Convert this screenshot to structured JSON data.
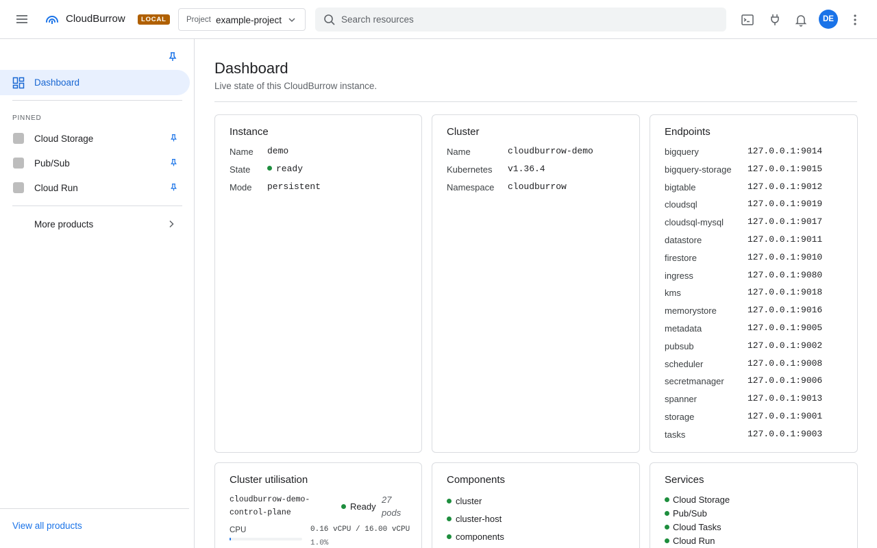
{
  "header": {
    "app_name": "CloudBurrow",
    "env_badge": "LOCAL",
    "project_label": "Project",
    "project_value": "example-project",
    "search_placeholder": "Search resources",
    "avatar_initials": "DE"
  },
  "sidebar": {
    "active_item": "Dashboard",
    "pinned_section_label": "PINNED",
    "pinned_items": [
      {
        "label": "Cloud Storage"
      },
      {
        "label": "Pub/Sub"
      },
      {
        "label": "Cloud Run"
      }
    ],
    "more_products_label": "More products",
    "view_all_label": "View all products"
  },
  "main": {
    "title": "Dashboard",
    "subtitle": "Live state of this CloudBurrow instance.",
    "instance": {
      "title": "Instance",
      "rows": [
        {
          "key": "Name",
          "value": "demo"
        },
        {
          "key": "State",
          "value": "ready"
        },
        {
          "key": "Mode",
          "value": "persistent"
        }
      ]
    },
    "cluster": {
      "title": "Cluster",
      "rows": [
        {
          "key": "Name",
          "value": "cloudburrow-demo"
        },
        {
          "key": "Kubernetes",
          "value": "v1.36.4"
        },
        {
          "key": "Namespace",
          "value": "cloudburrow"
        }
      ]
    },
    "endpoints": {
      "title": "Endpoints",
      "rows": [
        {
          "key": "bigquery",
          "value": "127.0.0.1:9014"
        },
        {
          "key": "bigquery-storage",
          "value": "127.0.0.1:9015"
        },
        {
          "key": "bigtable",
          "value": "127.0.0.1:9012"
        },
        {
          "key": "cloudsql",
          "value": "127.0.0.1:9019"
        },
        {
          "key": "cloudsql-mysql",
          "value": "127.0.0.1:9017"
        },
        {
          "key": "datastore",
          "value": "127.0.0.1:9011"
        },
        {
          "key": "firestore",
          "value": "127.0.0.1:9010"
        },
        {
          "key": "ingress",
          "value": "127.0.0.1:9080"
        },
        {
          "key": "kms",
          "value": "127.0.0.1:9018"
        },
        {
          "key": "memorystore",
          "value": "127.0.0.1:9016"
        },
        {
          "key": "metadata",
          "value": "127.0.0.1:9005"
        },
        {
          "key": "pubsub",
          "value": "127.0.0.1:9002"
        },
        {
          "key": "scheduler",
          "value": "127.0.0.1:9008"
        },
        {
          "key": "secretmanager",
          "value": "127.0.0.1:9006"
        },
        {
          "key": "spanner",
          "value": "127.0.0.1:9013"
        },
        {
          "key": "storage",
          "value": "127.0.0.1:9001"
        },
        {
          "key": "tasks",
          "value": "127.0.0.1:9003"
        }
      ]
    },
    "utilisation": {
      "title": "Cluster utilisation",
      "node_name_line1": "cloudburrow-demo-",
      "node_name_line2": "control-plane",
      "node_status": "Ready",
      "pods_line1": "27",
      "pods_line2": "pods",
      "cpu_label": "CPU",
      "cpu_value": "0.16 vCPU / 16.00 vCPU",
      "cpu_percent_text": "1.0%",
      "cpu_fraction": 0.01
    },
    "components": {
      "title": "Components",
      "items": [
        "cluster",
        "cluster-host",
        "components"
      ]
    },
    "services": {
      "title": "Services",
      "items": [
        "Cloud Storage",
        "Pub/Sub",
        "Cloud Tasks",
        "Cloud Run"
      ]
    }
  },
  "colors": {
    "accent": "#1a73e8",
    "status_ok": "#1e8e3e",
    "badge": "#b06000"
  }
}
